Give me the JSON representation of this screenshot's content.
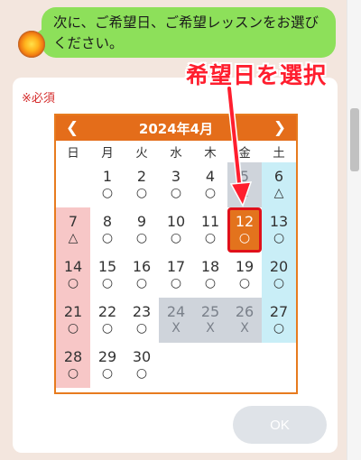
{
  "chat": {
    "message": "次に、ご希望日、ご希望レッスンをお選びください。"
  },
  "form": {
    "required_label": "※必須",
    "ok_label": "OK"
  },
  "annotation": {
    "text": "希望日を選択"
  },
  "calendar": {
    "month_label": "2024年4月",
    "prev_icon": "chevron-left-icon",
    "next_icon": "chevron-right-icon",
    "weekdays": [
      "日",
      "月",
      "火",
      "水",
      "木",
      "金",
      "土"
    ],
    "weeks": [
      [
        null,
        {
          "day": "1",
          "mark": "○"
        },
        {
          "day": "2",
          "mark": "○"
        },
        {
          "day": "3",
          "mark": "○"
        },
        {
          "day": "4",
          "mark": "○"
        },
        {
          "day": "5",
          "mark": "x",
          "status": "full"
        },
        {
          "day": "6",
          "mark": "△"
        }
      ],
      [
        {
          "day": "7",
          "mark": "△"
        },
        {
          "day": "8",
          "mark": "○"
        },
        {
          "day": "9",
          "mark": "○"
        },
        {
          "day": "10",
          "mark": "○"
        },
        {
          "day": "11",
          "mark": "○"
        },
        {
          "day": "12",
          "mark": "○",
          "status": "selected"
        },
        {
          "day": "13",
          "mark": "○"
        }
      ],
      [
        {
          "day": "14",
          "mark": "○"
        },
        {
          "day": "15",
          "mark": "○"
        },
        {
          "day": "16",
          "mark": "○"
        },
        {
          "day": "17",
          "mark": "○"
        },
        {
          "day": "18",
          "mark": "○"
        },
        {
          "day": "19",
          "mark": "○"
        },
        {
          "day": "20",
          "mark": "○"
        }
      ],
      [
        {
          "day": "21",
          "mark": "○"
        },
        {
          "day": "22",
          "mark": "○"
        },
        {
          "day": "23",
          "mark": "○"
        },
        {
          "day": "24",
          "mark": "X",
          "status": "full"
        },
        {
          "day": "25",
          "mark": "X",
          "status": "full"
        },
        {
          "day": "26",
          "mark": "X",
          "status": "full"
        },
        {
          "day": "27",
          "mark": "○"
        }
      ],
      [
        {
          "day": "28",
          "mark": "○"
        },
        {
          "day": "29",
          "mark": "○"
        },
        {
          "day": "30",
          "mark": "○"
        },
        null,
        null,
        null,
        null
      ]
    ]
  },
  "colors": {
    "bubble": "#8de05a",
    "header": "#e46d1a",
    "sunday": "#f7c7c7",
    "saturday": "#c9eef7",
    "full": "#cfd4db",
    "selected": "#e3731d",
    "annotation": "#ff1e2e"
  }
}
